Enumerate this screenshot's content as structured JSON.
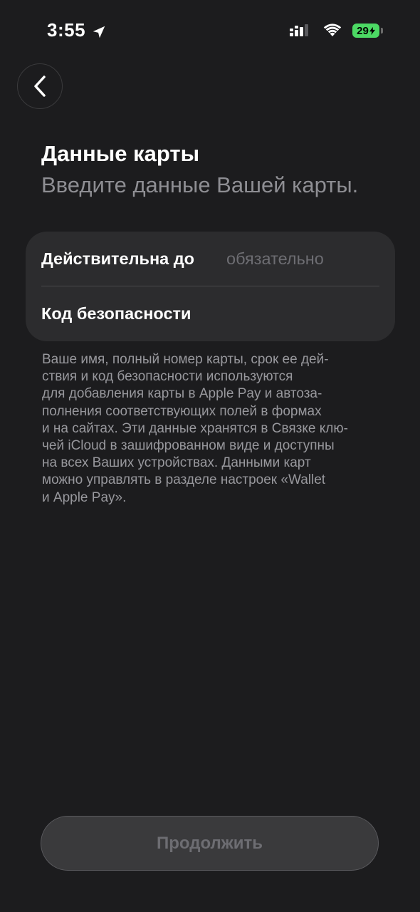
{
  "status_bar": {
    "time": "3:55",
    "battery_level": "29",
    "icons": [
      "location-arrow-icon",
      "signal-icon",
      "wifi-icon",
      "battery-charging-icon"
    ]
  },
  "header": {
    "back_icon": "chevron-left-icon",
    "title": "Данные карты",
    "subtitle": "Введите данные Вашей карты."
  },
  "form": {
    "rows": [
      {
        "label": "Действительна до",
        "placeholder": "обязательно",
        "value": ""
      },
      {
        "label": "Код безопасности",
        "placeholder": "",
        "value": ""
      }
    ]
  },
  "info": {
    "lines": [
      "Ваше имя, полный номер карты, срок ее дей-",
      "ствия и код безопасности используются",
      "для добавления карты в Apple Pay и автоза-",
      "полнения соответствующих полей в формах",
      "и на сайтах. Эти данные хранятся в Связке клю-",
      "чей iCloud в зашифрованном виде и доступны",
      "на всех Ваших устройствах. Данными карт",
      "можно управлять в разделе настроек «Wallet",
      "и Apple Pay»."
    ]
  },
  "footer": {
    "continue_label": "Продолжить"
  },
  "colors": {
    "background": "#1c1c1e",
    "card": "#2c2c2e",
    "secondary_text": "#8e8e93",
    "battery": "#4cd964",
    "disabled_button": "#3a3a3c"
  }
}
